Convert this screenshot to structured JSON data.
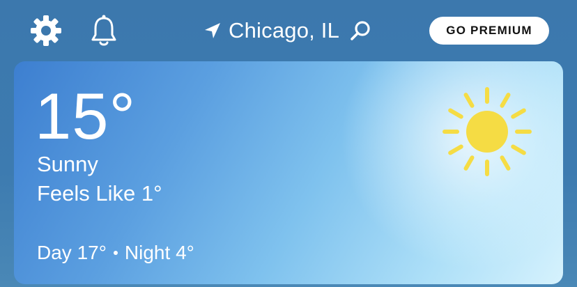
{
  "header": {
    "location": "Chicago, IL",
    "premium_label": "GO PREMIUM",
    "icons": {
      "settings": "gear-icon",
      "notifications": "bell-icon",
      "location": "location-arrow-icon",
      "search": "search-icon"
    }
  },
  "current": {
    "temperature": "15°",
    "condition": "Sunny",
    "feels_like": "Feels Like 1°",
    "day": "Day 17°",
    "night": "Night 4°",
    "condition_icon": "sun-icon"
  },
  "colors": {
    "background": "#3c78ad",
    "sun": "#f5dc44",
    "premium_button": "#ffffff",
    "premium_text": "#111111"
  }
}
